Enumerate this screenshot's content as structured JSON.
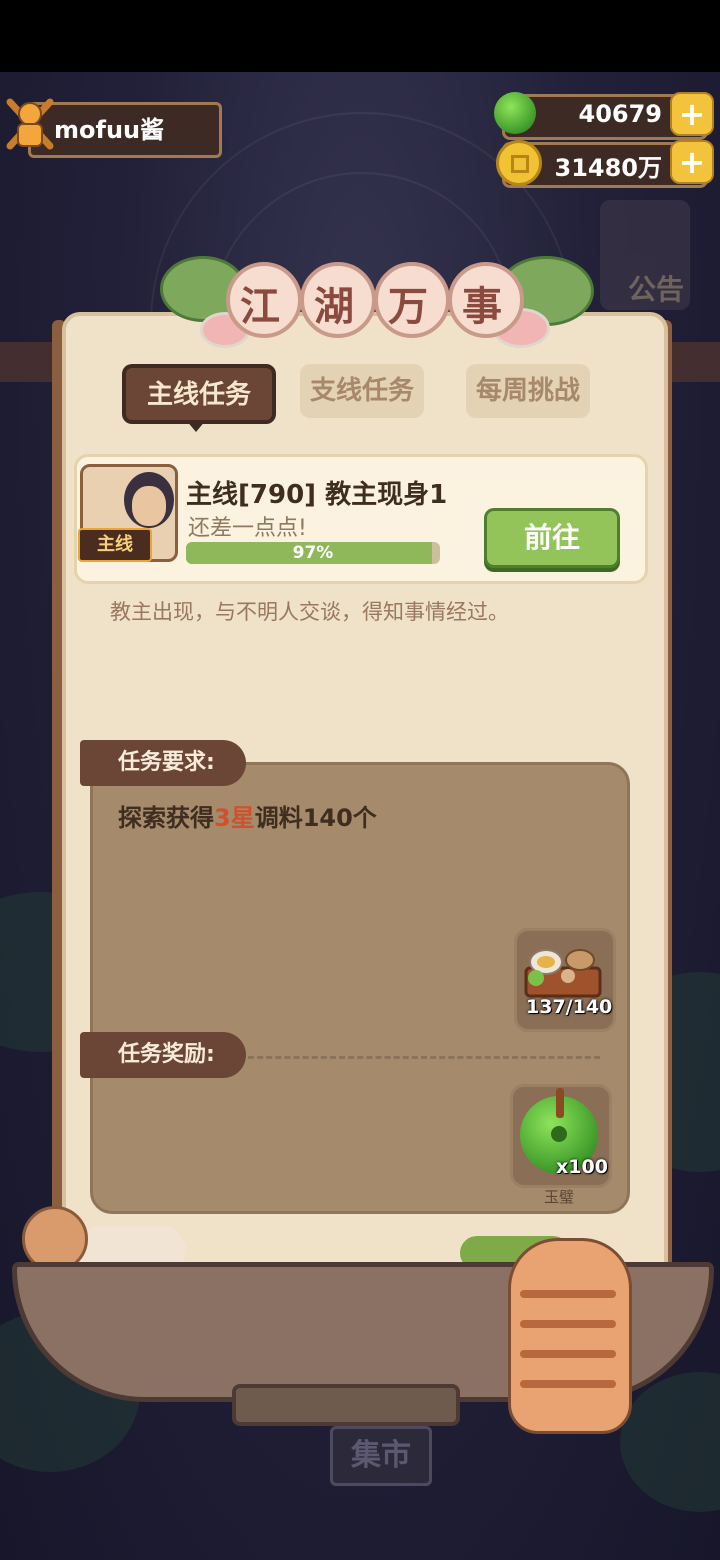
{
  "hud": {
    "player_name": "mofuu酱",
    "jade_count": "40679",
    "coin_count": "31480万"
  },
  "background": {
    "notice": "公告",
    "market": "集市"
  },
  "panel": {
    "title_chars": [
      "江",
      "湖",
      "万",
      "事"
    ],
    "tabs": [
      "主线任务",
      "支线任务",
      "每周挑战"
    ],
    "active_tab": "主线任务"
  },
  "task": {
    "badge": "主线",
    "title": "主线[790] 教主现身1",
    "subtitle": "还差一点点!",
    "progress_percent": 97,
    "progress_label": "97%",
    "go_button": "前往",
    "description": "教主出现，与不明人交谈，得知事情经过。"
  },
  "requirement": {
    "label": "任务要求:",
    "text_prefix": "探索获得",
    "text_highlight": "3星",
    "text_suffix": "调料140个",
    "item_count": "137/140"
  },
  "reward": {
    "label": "任务奖励:",
    "item_count": "x100",
    "item_name": "玉璧"
  },
  "colors": {
    "accent_green": "#92c45a",
    "highlight_red": "#d1512f",
    "tab_active": "#6b4636"
  }
}
